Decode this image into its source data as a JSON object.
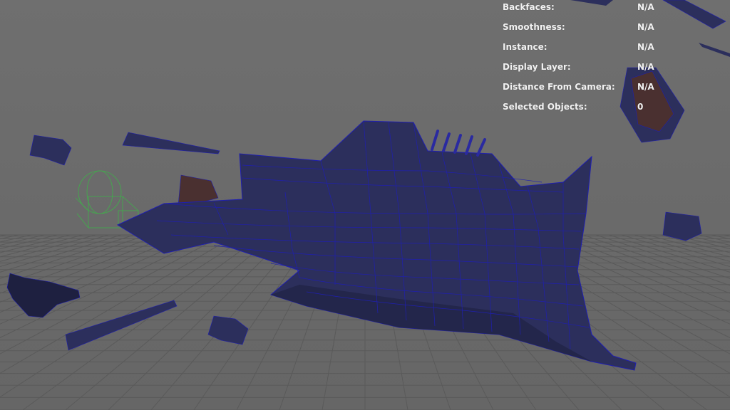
{
  "viewport": {
    "background_color": "#6b6b6b",
    "grid_color": "#5a5a5a",
    "mesh_fill_color": "#2c2f5c",
    "mesh_wire_color": "#1f1fb0",
    "debris_brown_color": "#4a3030",
    "camera_wire_color": "#3fb04a"
  },
  "hud": {
    "rows": [
      {
        "label": "Backfaces:",
        "value": "N/A"
      },
      {
        "label": "Smoothness:",
        "value": "N/A"
      },
      {
        "label": "Instance:",
        "value": "N/A"
      },
      {
        "label": "Display Layer:",
        "value": "N/A"
      },
      {
        "label": "Distance From Camera:",
        "value": "N/A"
      },
      {
        "label": "Selected Objects:",
        "value": "0"
      }
    ]
  }
}
